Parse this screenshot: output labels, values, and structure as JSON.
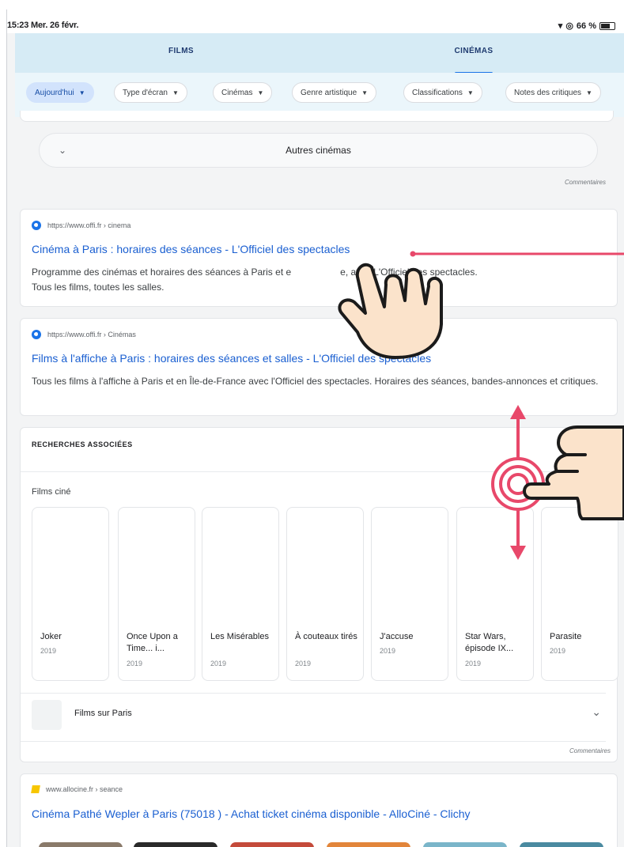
{
  "status": {
    "time_date": "15:23  Mer. 26 févr.",
    "battery": "66 %",
    "icons": [
      "wifi-icon",
      "location-icon",
      "battery-icon"
    ]
  },
  "tabs": [
    {
      "label": "FILMS"
    },
    {
      "label": "CINÉMAS",
      "selected": true
    }
  ],
  "filters": [
    {
      "label": "Aujourd'hui",
      "active": true
    },
    {
      "label": "Type d'écran"
    },
    {
      "label": "Cinémas"
    },
    {
      "label": "Genre artistique"
    },
    {
      "label": "Classifications"
    },
    {
      "label": "Notes des critiques"
    }
  ],
  "others_button": {
    "label": "Autres cinémas"
  },
  "feedback_label": "Commentaires",
  "results": [
    {
      "source": "https://www.offi.fr › cinema",
      "title": "Cinéma à Paris : horaires des séances - L'Officiel des spectacles",
      "snippet_a": "Programme des cinémas et horaires des séances à Paris et e",
      "snippet_b": "e, avec L'Officiel des spectacles.",
      "snippet_c": "Tous les films, toutes les salles."
    },
    {
      "source": "https://www.offi.fr › Cinémas",
      "title": "Films à l'affiche à Paris : horaires des séances et salles - L'Officiel des spectacles",
      "snippet": "Tous les films à l'affiche à Paris et en Île-de-France avec l'Officiel des spectacles. Horaires des séances, bandes-annonces et critiques."
    }
  ],
  "related": {
    "heading": "RECHERCHES ASSOCIÉES",
    "subheading": "Films ciné",
    "movies": [
      {
        "title": "Joker",
        "year": "2019"
      },
      {
        "title": "Once Upon a Time... i...",
        "year": "2019"
      },
      {
        "title": "Les Misérables",
        "year": "2019"
      },
      {
        "title": "À couteaux tirés",
        "year": "2019"
      },
      {
        "title": "J'accuse",
        "year": "2019"
      },
      {
        "title": "Star Wars, épisode IX...",
        "year": "2019"
      },
      {
        "title": "Parasite",
        "year": "2019"
      }
    ],
    "row_label": "Films sur Paris"
  },
  "allocine": {
    "source": "www.allocine.fr › seance",
    "title": "Cinéma Pathé Wepler à Paris (75018 ) - Achat ticket cinéma disponible - AlloCiné - Clichy"
  },
  "colors": {
    "accent": "#e8486a",
    "link": "#1a5fd1",
    "tab_bg": "#d6ebf5",
    "hand_fill": "#fbe3cb"
  }
}
